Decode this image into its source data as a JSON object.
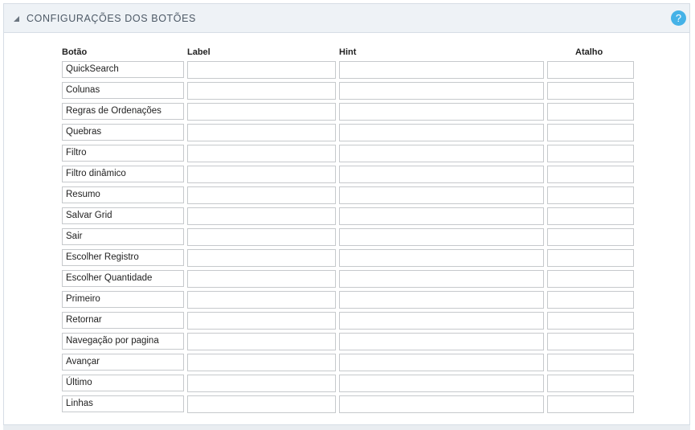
{
  "header": {
    "title": "CONFIGURAÇÕES DOS BOTÕES",
    "help_label": "?"
  },
  "table": {
    "columns": [
      "Botão",
      "Label",
      "Hint",
      "Atalho"
    ],
    "rows": [
      {
        "button": "QuickSearch",
        "label": "",
        "hint": "",
        "shortcut": ""
      },
      {
        "button": "Colunas",
        "label": "",
        "hint": "",
        "shortcut": ""
      },
      {
        "button": "Regras de Ordenações",
        "label": "",
        "hint": "",
        "shortcut": ""
      },
      {
        "button": "Quebras",
        "label": "",
        "hint": "",
        "shortcut": ""
      },
      {
        "button": "Filtro",
        "label": "",
        "hint": "",
        "shortcut": ""
      },
      {
        "button": "Filtro dinâmico",
        "label": "",
        "hint": "",
        "shortcut": ""
      },
      {
        "button": "Resumo",
        "label": "",
        "hint": "",
        "shortcut": ""
      },
      {
        "button": "Salvar Grid",
        "label": "",
        "hint": "",
        "shortcut": ""
      },
      {
        "button": "Sair",
        "label": "",
        "hint": "",
        "shortcut": ""
      },
      {
        "button": "Escolher Registro",
        "label": "",
        "hint": "",
        "shortcut": ""
      },
      {
        "button": "Escolher Quantidade",
        "label": "",
        "hint": "",
        "shortcut": ""
      },
      {
        "button": "Primeiro",
        "label": "",
        "hint": "",
        "shortcut": ""
      },
      {
        "button": "Retornar",
        "label": "",
        "hint": "",
        "shortcut": ""
      },
      {
        "button": "Navegação por pagina",
        "label": "",
        "hint": "",
        "shortcut": ""
      },
      {
        "button": "Avançar",
        "label": "",
        "hint": "",
        "shortcut": ""
      },
      {
        "button": "Último",
        "label": "",
        "hint": "",
        "shortcut": ""
      },
      {
        "button": "Linhas",
        "label": "",
        "hint": "",
        "shortcut": ""
      }
    ]
  }
}
